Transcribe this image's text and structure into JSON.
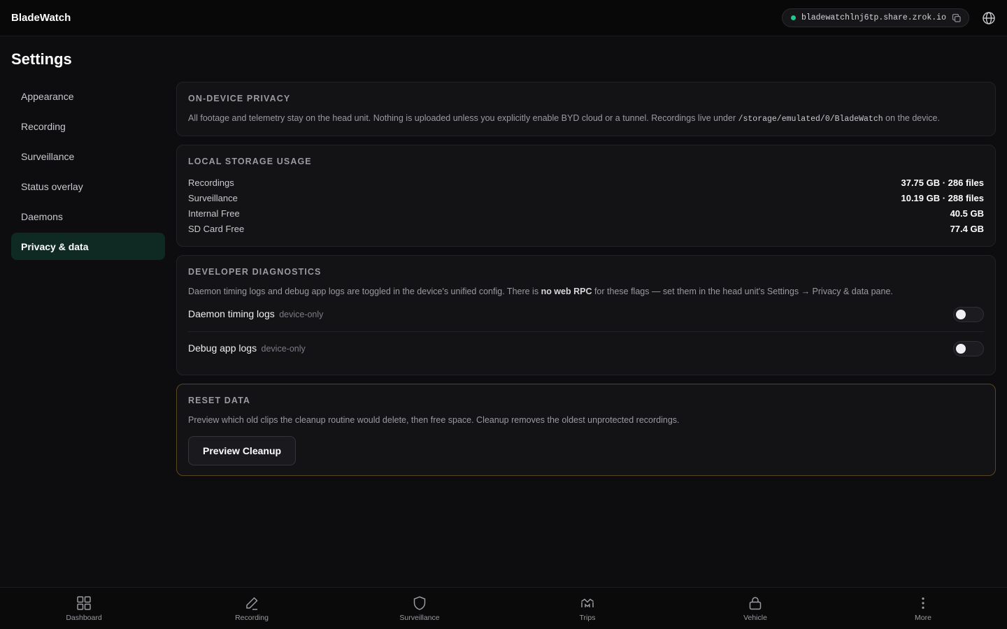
{
  "app": {
    "name": "BladeWatch"
  },
  "topbar": {
    "url": "bladewatchlnj6tp.share.zrok.io",
    "status_color": "#22c58b"
  },
  "page": {
    "title": "Settings"
  },
  "sidebar": {
    "items": [
      {
        "label": "Appearance",
        "active": false
      },
      {
        "label": "Recording",
        "active": false
      },
      {
        "label": "Surveillance",
        "active": false
      },
      {
        "label": "Status overlay",
        "active": false
      },
      {
        "label": "Daemons",
        "active": false
      },
      {
        "label": "Privacy & data",
        "active": true
      }
    ]
  },
  "privacy": {
    "title": "On-Device Privacy",
    "desc_before": "All footage and telemetry stay on the head unit. Nothing is uploaded unless you explicitly enable BYD cloud or a tunnel. Recordings live under ",
    "desc_path": "/storage/emulated/0/BladeWatch",
    "desc_after": " on the device."
  },
  "storage": {
    "title": "Local Storage Usage",
    "rows": [
      {
        "label": "Recordings",
        "value": "37.75 GB · 286 files"
      },
      {
        "label": "Surveillance",
        "value": "10.19 GB · 288 files"
      },
      {
        "label": "Internal Free",
        "value": "40.5 GB"
      },
      {
        "label": "SD Card Free",
        "value": "77.4 GB"
      }
    ]
  },
  "diagnostics": {
    "title": "Developer Diagnostics",
    "desc_before": "Daemon timing logs and debug app logs are toggled in the device's unified config. There is ",
    "desc_bold": "no web RPC",
    "desc_after": " for these flags — set them in the head unit's Settings → Privacy & data pane.",
    "toggles": [
      {
        "label": "Daemon timing logs",
        "tag": "device-only",
        "enabled": false
      },
      {
        "label": "Debug app logs",
        "tag": "device-only",
        "enabled": false
      }
    ]
  },
  "reset": {
    "title": "Reset Data",
    "desc": "Preview which old clips the cleanup routine would delete, then free space. Cleanup removes the oldest unprotected recordings.",
    "button": "Preview Cleanup",
    "border_color": "#5a4722"
  },
  "bottom_nav": [
    {
      "label": "Dashboard",
      "icon": "grid-icon"
    },
    {
      "label": "Recording",
      "icon": "pen-icon"
    },
    {
      "label": "Surveillance",
      "icon": "shield-icon"
    },
    {
      "label": "Trips",
      "icon": "route-icon"
    },
    {
      "label": "Vehicle",
      "icon": "lock-icon"
    },
    {
      "label": "More",
      "icon": "more-vertical-icon"
    }
  ]
}
